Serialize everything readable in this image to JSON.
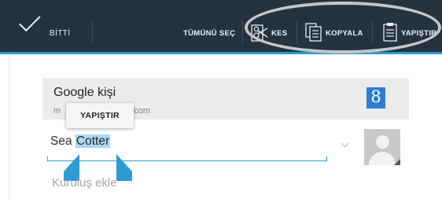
{
  "action_bar": {
    "done_label": "BİTTİ",
    "select_all_label": "TÜMÜNÜ SEÇ",
    "cut_label": "KES",
    "copy_label": "KOPYALA",
    "paste_label": "YAPIŞTIR",
    "icons": {
      "done": "check-icon",
      "cut": "scissors-icon",
      "copy": "copy-icon",
      "paste": "clipboard-icon"
    }
  },
  "account": {
    "name": "Google kişi",
    "email_start": "m",
    "email_end": ".com",
    "badge": "8"
  },
  "paste_popup": {
    "label": "YAPIŞTIR"
  },
  "contact": {
    "name_prefix": "Sea ",
    "name_selected": "Cotter",
    "add_organization": "Kuruluş ekle"
  },
  "colors": {
    "action_bar": "#25333f",
    "accent": "#2e9bd3",
    "selection": "#a9d8f4"
  }
}
